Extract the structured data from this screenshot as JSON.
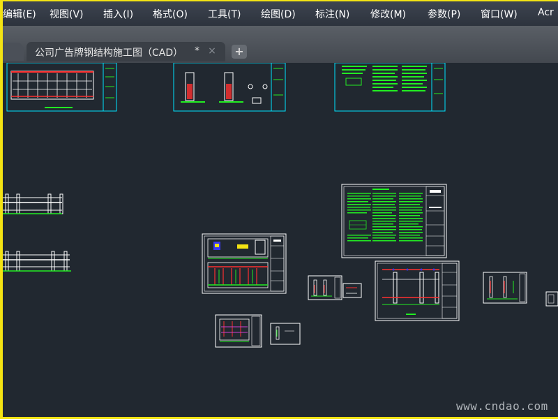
{
  "menubar": {
    "items": [
      {
        "label": "编辑(E)"
      },
      {
        "label": "视图(V)"
      },
      {
        "label": "插入(I)"
      },
      {
        "label": "格式(O)"
      },
      {
        "label": "工具(T)"
      },
      {
        "label": "绘图(D)"
      },
      {
        "label": "标注(N)"
      },
      {
        "label": "修改(M)"
      },
      {
        "label": "参数(P)"
      },
      {
        "label": "窗口(W)"
      },
      {
        "label": "Acr"
      }
    ]
  },
  "tabs": {
    "document": {
      "label": "公司广告牌钢结构施工图（CAD）",
      "modified": "*",
      "close": "×"
    },
    "new_tab": "+"
  },
  "canvas": {
    "background": "#212830",
    "sheet_border_color": "#ffffff",
    "title_frame_color": "#00e5ff",
    "notes_color": "#22ee22"
  },
  "watermark": "www.cndao.com"
}
